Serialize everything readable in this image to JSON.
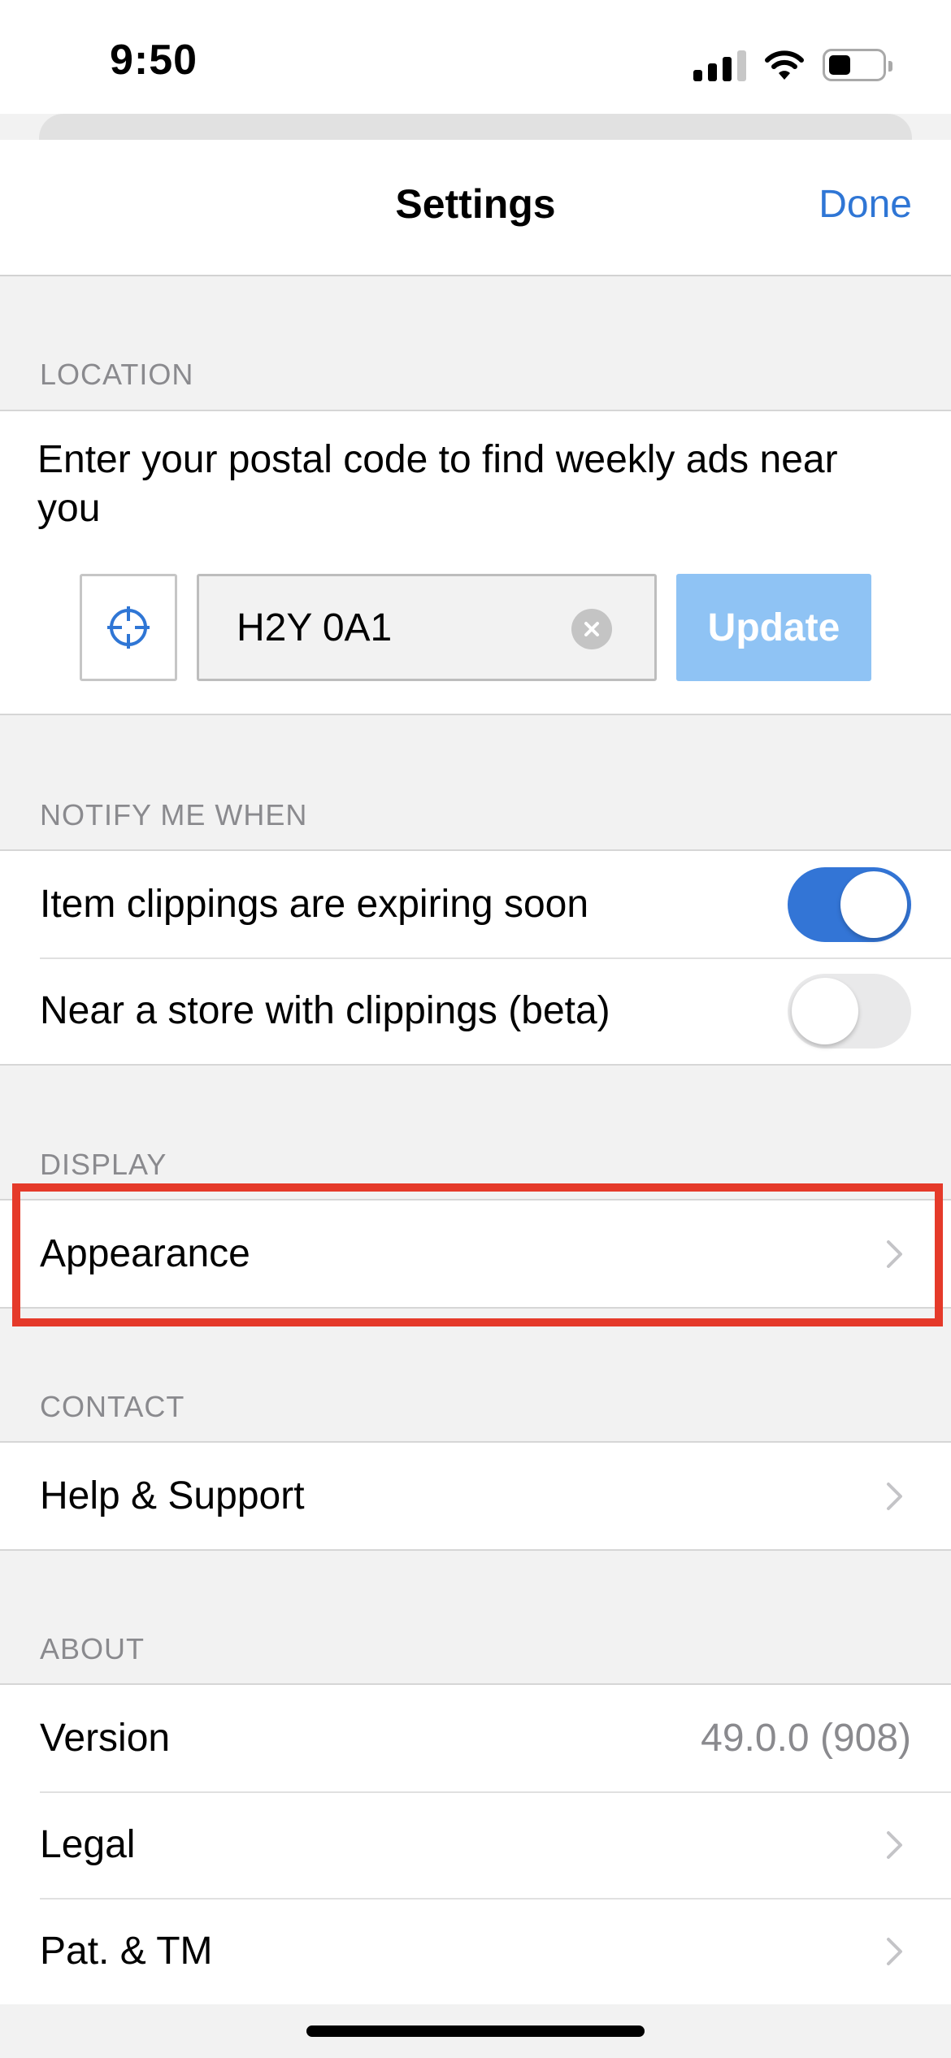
{
  "status_bar": {
    "time": "9:50"
  },
  "nav": {
    "title": "Settings",
    "done_label": "Done"
  },
  "location": {
    "header": "LOCATION",
    "description": "Enter your postal code to find weekly ads near you",
    "postal_code": "H2Y 0A1",
    "update_label": "Update"
  },
  "notify": {
    "header": "NOTIFY ME WHEN",
    "items": [
      {
        "label": "Item clippings are expiring soon",
        "enabled": true
      },
      {
        "label": "Near a store with clippings (beta)",
        "enabled": false
      }
    ]
  },
  "display": {
    "header": "DISPLAY",
    "items": [
      {
        "label": "Appearance"
      }
    ]
  },
  "contact": {
    "header": "CONTACT",
    "items": [
      {
        "label": "Help & Support"
      }
    ]
  },
  "about": {
    "header": "ABOUT",
    "version_label": "Version",
    "version_value": "49.0.0 (908)",
    "items": [
      {
        "label": "Legal"
      },
      {
        "label": "Pat. & TM"
      }
    ]
  },
  "colors": {
    "accent": "#2f76d5",
    "toggle_on": "#3375d6",
    "update_button": "#8fc3f4",
    "highlight": "#e53a2a",
    "section_header": "#8a8a8e"
  }
}
